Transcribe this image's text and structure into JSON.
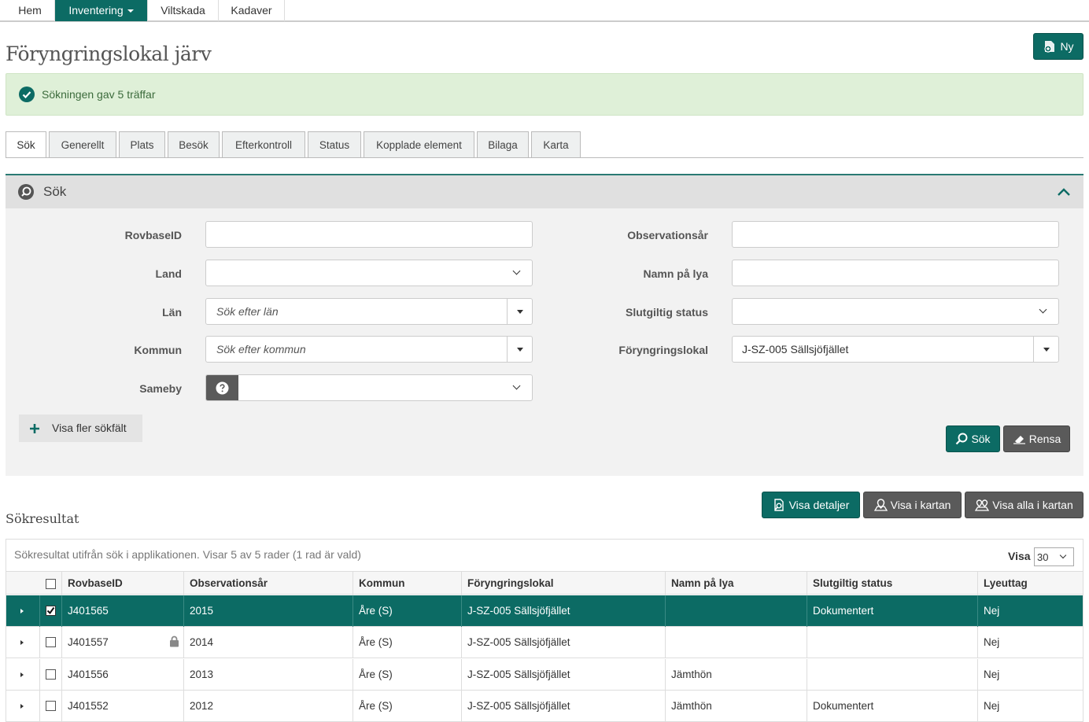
{
  "topnav": {
    "items": [
      {
        "label": "Hem"
      },
      {
        "label": "Inventering"
      },
      {
        "label": "Viltskada"
      },
      {
        "label": "Kadaver"
      }
    ]
  },
  "page": {
    "title": "Föryngringslokal järv",
    "new_label": "Ny"
  },
  "alert": {
    "text": "Sökningen gav 5 träffar"
  },
  "tabs": [
    "Sök",
    "Generellt",
    "Plats",
    "Besök",
    "Efterkontroll",
    "Status",
    "Kopplade element",
    "Bilaga",
    "Karta"
  ],
  "search": {
    "title": "Sök",
    "labels": {
      "rovbaseid": "RovbaseID",
      "land": "Land",
      "lan": "Län",
      "kommun": "Kommun",
      "sameby": "Sameby",
      "observationsar": "Observationsår",
      "namn_pa_lya": "Namn på lya",
      "slutgiltig_status": "Slutgiltig status",
      "foryngringslokal": "Föryngringslokal"
    },
    "placeholders": {
      "lan": "Sök efter län",
      "kommun": "Sök efter kommun"
    },
    "values": {
      "foryngringslokal": "J-SZ-005 Sällsjöfjället"
    },
    "more_fields": "Visa fler sökfält",
    "search_button": "Sök",
    "clear_button": "Rensa"
  },
  "results": {
    "title": "Sökresultat",
    "buttons": {
      "details": "Visa detaljer",
      "map": "Visa i kartan",
      "map_all": "Visa alla i kartan"
    },
    "info": "Sökresultat utifrån sök i applikationen. Visar 5 av 5 rader (1 rad är vald)",
    "visa_label": "Visa",
    "page_size": "30",
    "columns": [
      "RovbaseID",
      "Observationsår",
      "Kommun",
      "Föryngringslokal",
      "Namn på lya",
      "Slutgiltig status",
      "Lyeuttag"
    ],
    "rows": [
      {
        "id": "J401565",
        "year": "2015",
        "kommun": "Åre (S)",
        "lokal": "J-SZ-005 Sällsjöfjället",
        "lya": "",
        "status": "Dokumentert",
        "uttag": "Nej",
        "selected": true,
        "locked": false
      },
      {
        "id": "J401557",
        "year": "2014",
        "kommun": "Åre (S)",
        "lokal": "J-SZ-005 Sällsjöfjället",
        "lya": "",
        "status": "",
        "uttag": "Nej",
        "selected": false,
        "locked": true
      },
      {
        "id": "J401556",
        "year": "2013",
        "kommun": "Åre (S)",
        "lokal": "J-SZ-005 Sällsjöfjället",
        "lya": "Jämthön",
        "status": "",
        "uttag": "Nej",
        "selected": false,
        "locked": false
      },
      {
        "id": "J401552",
        "year": "2012",
        "kommun": "Åre (S)",
        "lokal": "J-SZ-005 Sällsjöfjället",
        "lya": "Jämthön",
        "status": "Dokumentert",
        "uttag": "Nej",
        "selected": false,
        "locked": false
      }
    ]
  },
  "colors": {
    "accent": "#0c6b64",
    "success_bg": "#dff0d8",
    "panel_bg": "#f2f2f2"
  }
}
